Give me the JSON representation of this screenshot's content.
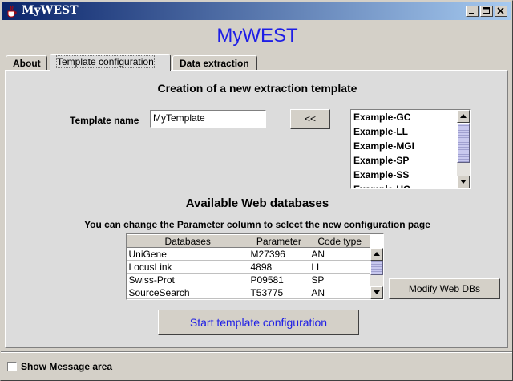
{
  "window": {
    "title": "MyWEST"
  },
  "app_title": "MyWEST",
  "tabs": [
    {
      "label": "About"
    },
    {
      "label": "Template configuration",
      "selected": true
    },
    {
      "label": "Data extraction"
    }
  ],
  "section_title": "Creation of a new extraction template",
  "template": {
    "label": "Template name",
    "value": "MyTemplate",
    "move_button": "<<"
  },
  "template_list": {
    "items": [
      "Example-GC",
      "Example-LL",
      "Example-MGI",
      "Example-SP",
      "Example-SS",
      "Example-UG"
    ]
  },
  "databases": {
    "heading": "Available Web databases",
    "hint": "You can change the Parameter column to select the new configuration page",
    "columns": [
      "Databases",
      "Parameter",
      "Code type"
    ],
    "rows": [
      [
        "UniGene",
        "M27396",
        "AN"
      ],
      [
        "LocusLink",
        "4898",
        "LL"
      ],
      [
        "Swiss-Prot",
        "P09581",
        "SP"
      ],
      [
        "SourceSearch",
        "T53775",
        "AN"
      ]
    ]
  },
  "modify_button": "Modify Web DBs",
  "start_button": "Start template configuration",
  "show_message": "Show Message area",
  "colors": {
    "title_blue": "#1e1ee6",
    "titlebar_start": "#0a246a",
    "titlebar_end": "#a6caf0"
  }
}
